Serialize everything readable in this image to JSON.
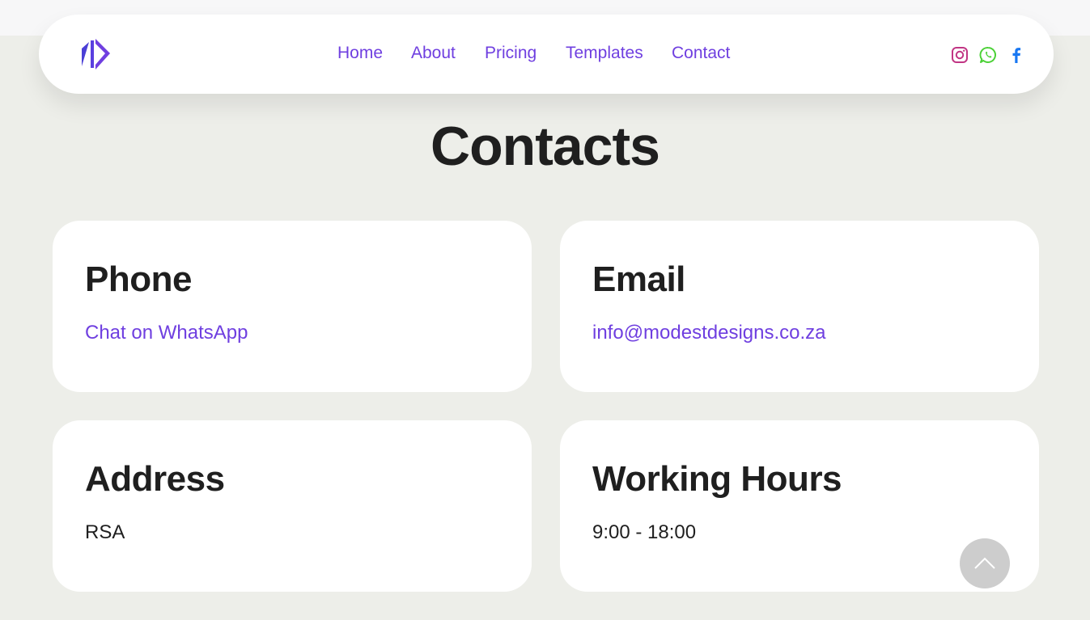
{
  "nav": {
    "links": [
      "Home",
      "About",
      "Pricing",
      "Templates",
      "Contact"
    ],
    "social": {
      "icons": [
        "instagram-icon",
        "whatsapp-icon",
        "facebook-icon"
      ],
      "colors": {
        "instagram": "#c13584",
        "whatsapp": "#4cd137",
        "facebook": "#1877f2"
      }
    },
    "logo_icon": "brand-logo-icon"
  },
  "page": {
    "title": "Contacts"
  },
  "cards": [
    {
      "title": "Phone",
      "value": "Chat on WhatsApp"
    },
    {
      "title": "Email",
      "value": "info@modestdesigns.co.za"
    },
    {
      "title": "Address",
      "value": "RSA"
    },
    {
      "title": "Working Hours",
      "value": "9:00 - 18:00"
    }
  ],
  "scroll_top_icon": "chevron-up-icon",
  "colors": {
    "accent": "#6f3fe0",
    "background": "#edeee9",
    "text": "#1f1f1f",
    "scroll_button": "#cdcdcd"
  }
}
